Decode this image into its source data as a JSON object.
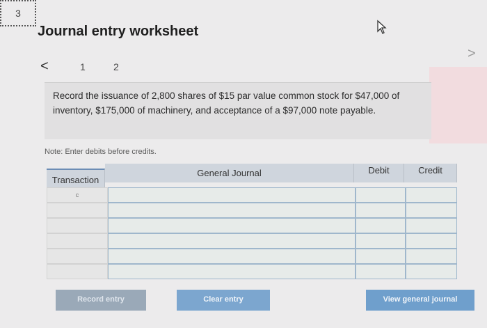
{
  "header": {
    "title": "Journal entry worksheet",
    "prev_label": "<",
    "next_label": ">",
    "steps": [
      "1",
      "2",
      "3"
    ]
  },
  "instructions": "Record the issuance of 2,800 shares of $15 par value common stock for $47,000 of inventory, $175,000 of machinery, and acceptance of a $97,000 note payable.",
  "note": "Note: Enter debits before credits.",
  "table": {
    "headers": {
      "transaction": "Transaction",
      "general_journal": "General Journal",
      "debit": "Debit",
      "credit": "Credit"
    },
    "rows": [
      {
        "transaction": "c",
        "account": "",
        "debit": "",
        "credit": ""
      },
      {
        "transaction": "",
        "account": "",
        "debit": "",
        "credit": ""
      },
      {
        "transaction": "",
        "account": "",
        "debit": "",
        "credit": ""
      },
      {
        "transaction": "",
        "account": "",
        "debit": "",
        "credit": ""
      },
      {
        "transaction": "",
        "account": "",
        "debit": "",
        "credit": ""
      },
      {
        "transaction": "",
        "account": "",
        "debit": "",
        "credit": ""
      }
    ]
  },
  "buttons": {
    "record": "Record entry",
    "clear": "Clear entry",
    "view": "View general journal"
  },
  "icons": {
    "cursor": "pointer-cursor-icon",
    "prev": "chevron-left-icon",
    "next": "chevron-right-icon"
  }
}
